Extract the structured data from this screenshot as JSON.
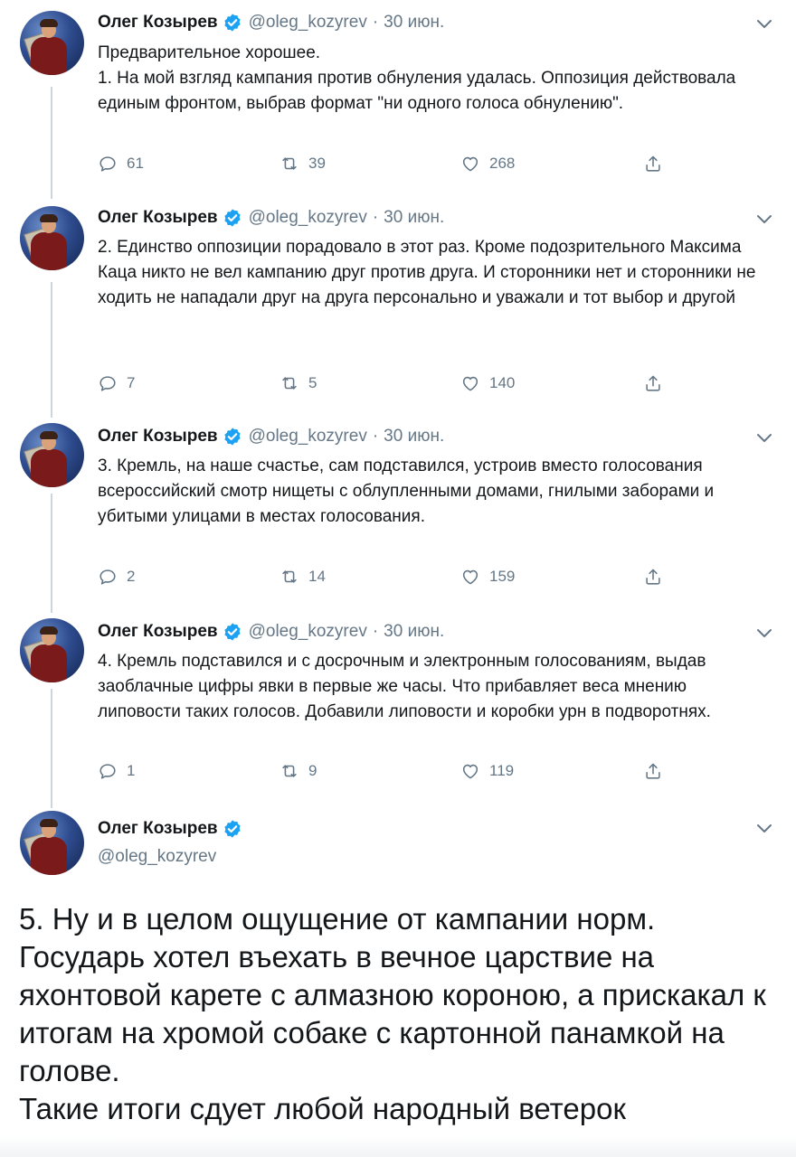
{
  "author": {
    "name": "Олег Козырев",
    "handle": "@oleg_kozyrev",
    "separator": "·"
  },
  "tweets": [
    {
      "date": "30 июн.",
      "text": "Предварительное хорошее.\n1. На мой взгляд кампания против обнуления удалась. Оппозиция действовала единым фронтом, выбрав формат \"ни одного голоса обнулению\".",
      "replies": "61",
      "retweets": "39",
      "likes": "268"
    },
    {
      "date": "30 июн.",
      "text": "2. Единство оппозиции порадовало в этот раз. Кроме подозрительного Максима Каца никто не вел кампанию друг против друга. И сторонники нет и сторонники не ходить не нападали друг на друга персонально и уважали и тот выбор и другой",
      "replies": "7",
      "retweets": "5",
      "likes": "140"
    },
    {
      "date": "30 июн.",
      "text": "3. Кремль, на наше счастье, сам подставился, устроив вместо голосования всероссийский смотр нищеты с облупленными домами, гнилыми заборами и убитыми улицами в местах голосования.",
      "replies": "2",
      "retweets": "14",
      "likes": "159"
    },
    {
      "date": "30 июн.",
      "text": "4. Кремль подставился и с досрочным и электронным голосованиям, выдав заоблачные цифры явки в первые же часы. Что прибавляет веса мнению липовости таких голосов. Добавили липовости и коробки урн в подворотнях.",
      "replies": "1",
      "retweets": "9",
      "likes": "119"
    }
  ],
  "final_tweet": {
    "text": "5. Ну и в целом ощущение от кампании норм.\nГосударь хотел въехать в вечное царствие на яхонтовой карете с алмазною короною, а прискакал к итогам на хромой собаке с картонной панамкой на голове.\nТакие итоги сдует любой народный ветерок"
  },
  "icons": {
    "verified": "verified-badge-icon",
    "more": "chevron-down-icon",
    "reply": "reply-bubble-icon",
    "retweet": "retweet-icon",
    "like": "heart-icon",
    "share": "share-icon"
  },
  "colors": {
    "text": "#14171a",
    "muted": "#657786",
    "verified": "#1da1f2",
    "thread_line": "#ccd6dd"
  }
}
